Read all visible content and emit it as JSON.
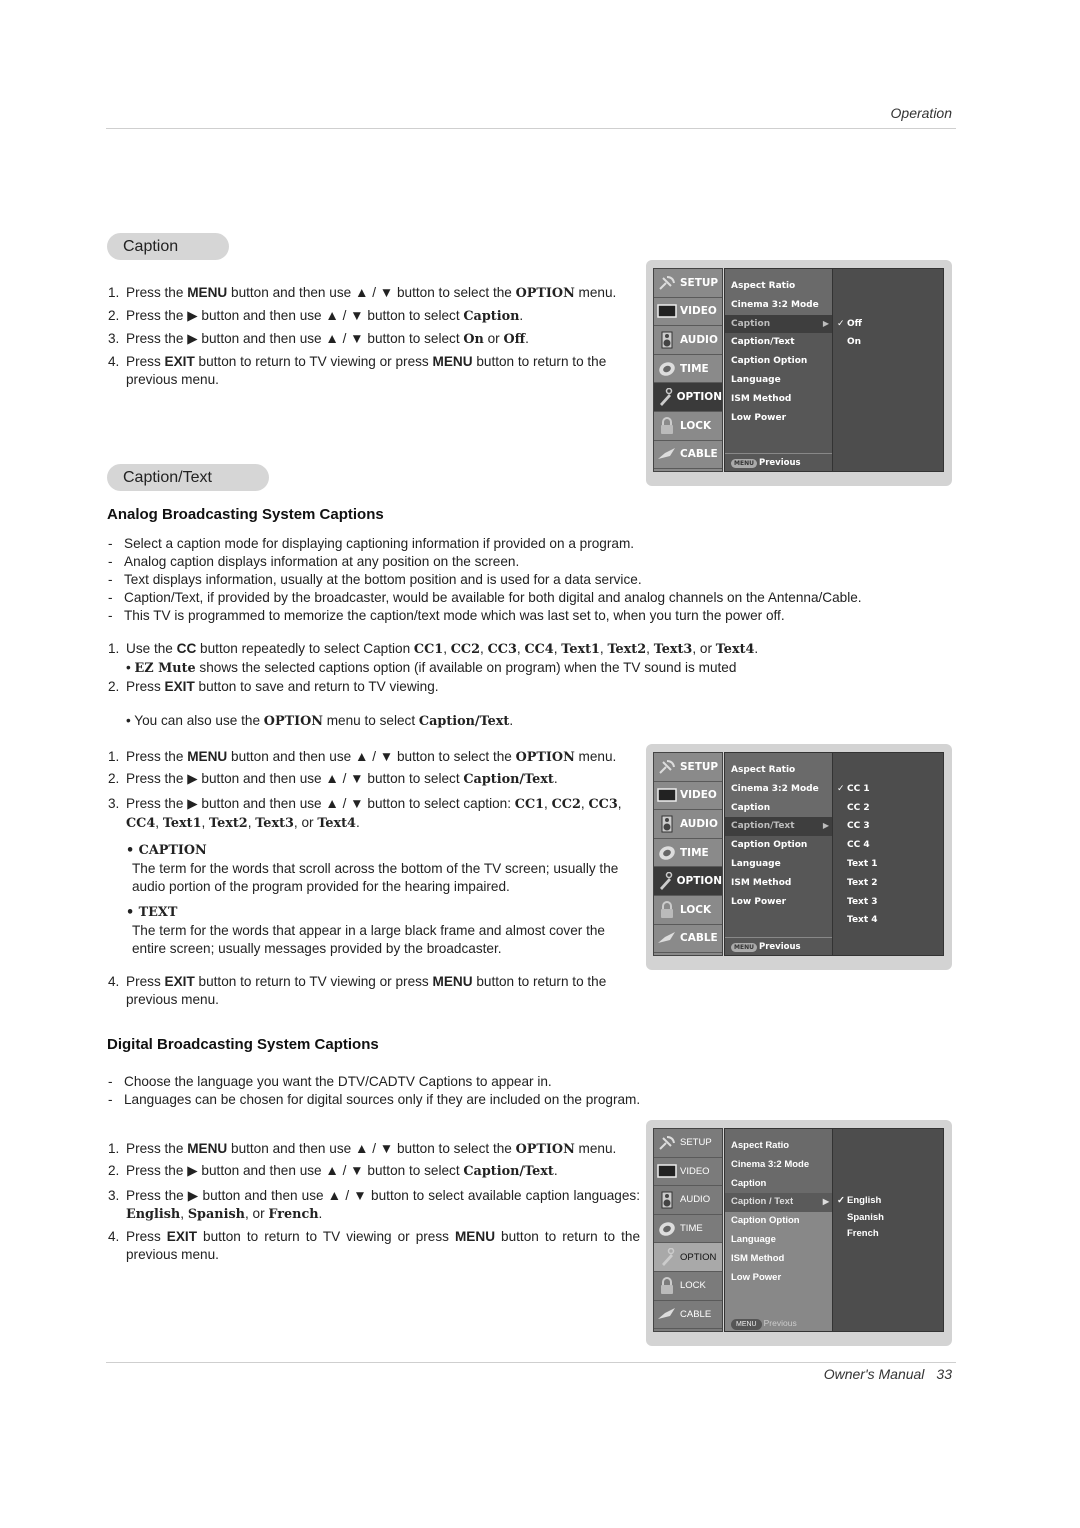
{
  "header": {
    "section": "Operation"
  },
  "footer": {
    "manual": "Owner's Manual",
    "page": "33"
  },
  "caption_section": {
    "title": "Caption",
    "steps": [
      {
        "n": "1.",
        "parts": [
          [
            "t",
            "Press the "
          ],
          [
            "b",
            "MENU"
          ],
          [
            "t",
            " button and then use ▲ / ▼  button to select the "
          ],
          [
            "s",
            "OPTION"
          ],
          [
            "t",
            " menu."
          ]
        ]
      },
      {
        "n": "2.",
        "parts": [
          [
            "t",
            "Press the ▶  button and then use ▲ / ▼ button to select "
          ],
          [
            "s",
            "Caption"
          ],
          [
            "t",
            "."
          ]
        ]
      },
      {
        "n": "3.",
        "parts": [
          [
            "t",
            "Press the ▶  button and then use ▲ / ▼ button to select "
          ],
          [
            "s",
            "On"
          ],
          [
            "t",
            " or "
          ],
          [
            "s",
            "Off"
          ],
          [
            "t",
            "."
          ]
        ]
      },
      {
        "n": "4.",
        "parts": [
          [
            "t",
            "Press "
          ],
          [
            "b",
            "EXIT"
          ],
          [
            "t",
            " button to return to TV viewing or press "
          ],
          [
            "b",
            "MENU"
          ],
          [
            "t",
            " button to return to the previous menu."
          ]
        ]
      }
    ]
  },
  "caption_text_section": {
    "title": "Caption/Text",
    "analog_heading": "Analog Broadcasting System Captions",
    "analog_bullets": [
      "Select a caption mode for displaying captioning information if provided on a program.",
      "Analog caption displays information at any position on the screen.",
      "Text displays information, usually at the bottom position and is used for a data service.",
      "Caption/Text, if provided by the broadcaster, would be available for both digital and analog channels on the Antenna/Cable.",
      "This TV is programmed to memorize the caption/text mode which was last set to, when you turn the power off."
    ],
    "cc_steps": [
      {
        "n": "1.",
        "parts": [
          [
            "t",
            "Use the "
          ],
          [
            "b",
            "CC"
          ],
          [
            "t",
            " button repeatedly to select Caption "
          ],
          [
            "s",
            "CC1"
          ],
          [
            "t",
            ", "
          ],
          [
            "s",
            "CC2"
          ],
          [
            "t",
            ", "
          ],
          [
            "s",
            "CC3"
          ],
          [
            "t",
            ", "
          ],
          [
            "s",
            "CC4"
          ],
          [
            "t",
            ", "
          ],
          [
            "s",
            "Text1"
          ],
          [
            "t",
            ", "
          ],
          [
            "s",
            "Text2"
          ],
          [
            "t",
            ", "
          ],
          [
            "s",
            "Text3"
          ],
          [
            "t",
            ", or "
          ],
          [
            "s",
            "Text4"
          ],
          [
            "t",
            "."
          ]
        ]
      },
      {
        "n": "",
        "parts": [
          [
            "t",
            "• "
          ],
          [
            "s",
            "EZ Mute"
          ],
          [
            "t",
            " shows the selected captions option (if available on program) when the TV sound is muted"
          ]
        ]
      },
      {
        "n": "2.",
        "parts": [
          [
            "t",
            "Press "
          ],
          [
            "b",
            "EXIT"
          ],
          [
            "t",
            " button to save and return to TV viewing."
          ]
        ]
      }
    ],
    "also_note": [
      [
        "t",
        "• You can also use the "
      ],
      [
        "s",
        "OPTION"
      ],
      [
        "t",
        " menu to select "
      ],
      [
        "s",
        "Caption/Text"
      ],
      [
        "t",
        "."
      ]
    ],
    "menu_steps": [
      {
        "n": "1.",
        "parts": [
          [
            "t",
            "Press the "
          ],
          [
            "b",
            "MENU"
          ],
          [
            "t",
            " button and then use ▲ / ▼  button to select the "
          ],
          [
            "s",
            "OPTION"
          ],
          [
            "t",
            " menu."
          ]
        ]
      },
      {
        "n": "2.",
        "parts": [
          [
            "t",
            "Press the ▶  button and then use ▲ / ▼ button to select "
          ],
          [
            "s",
            "Caption/Text"
          ],
          [
            "t",
            "."
          ]
        ]
      },
      {
        "n": "3.",
        "parts": [
          [
            "t",
            "Press the ▶  button and then use ▲ / ▼ button to select caption: "
          ],
          [
            "s",
            "CC1"
          ],
          [
            "t",
            ", "
          ],
          [
            "s",
            "CC2"
          ],
          [
            "t",
            ", "
          ],
          [
            "s",
            "CC3"
          ],
          [
            "t",
            ", "
          ],
          [
            "s",
            "CC4"
          ],
          [
            "t",
            ", "
          ],
          [
            "s",
            "Text1"
          ],
          [
            "t",
            ", "
          ],
          [
            "s",
            "Text2"
          ],
          [
            "t",
            ", "
          ],
          [
            "s",
            "Text3"
          ],
          [
            "t",
            ", or "
          ],
          [
            "s",
            "Text4"
          ],
          [
            "t",
            "."
          ]
        ]
      }
    ],
    "definitions": [
      {
        "term": "• CAPTION",
        "desc": "The term for the words that scroll across the bottom of the TV screen; usually the audio portion of the program provided for the hearing impaired."
      },
      {
        "term": "• TEXT",
        "desc": "The term for the words that appear in a large black frame and almost cover the entire screen; usually messages provided by the broadcaster."
      }
    ],
    "step4": {
      "n": "4.",
      "parts": [
        [
          "t",
          "Press "
        ],
        [
          "b",
          "EXIT"
        ],
        [
          "t",
          " button to return to TV viewing or press "
        ],
        [
          "b",
          "MENU"
        ],
        [
          "t",
          " button to return to the previous menu."
        ]
      ]
    },
    "digital_heading": "Digital Broadcasting System Captions",
    "digital_bullets": [
      "Choose the language you want the DTV/CADTV Captions to appear in.",
      "Languages can be chosen for digital sources only if they are included on the program."
    ],
    "digital_steps": [
      {
        "n": "1.",
        "parts": [
          [
            "t",
            "Press the "
          ],
          [
            "b",
            "MENU"
          ],
          [
            "t",
            " button and then use ▲ / ▼  button to select the "
          ],
          [
            "s",
            "OPTION"
          ],
          [
            "t",
            " menu."
          ]
        ]
      },
      {
        "n": "2.",
        "parts": [
          [
            "t",
            "Press the ▶  button and then use ▲ / ▼ button to select "
          ],
          [
            "s",
            "Caption/Text"
          ],
          [
            "t",
            "."
          ]
        ]
      },
      {
        "n": "3.",
        "parts": [
          [
            "t",
            "Press the ▶  button and then use ▲ / ▼ button to select available caption languages: "
          ],
          [
            "s",
            "English"
          ],
          [
            "t",
            ", "
          ],
          [
            "s",
            "Spanish"
          ],
          [
            "t",
            ", or "
          ],
          [
            "s",
            "French"
          ],
          [
            "t",
            "."
          ]
        ]
      },
      {
        "n": "4.",
        "parts": [
          [
            "t",
            "Press "
          ],
          [
            "b",
            "EXIT"
          ],
          [
            "t",
            " button to return to TV viewing or press "
          ],
          [
            "b",
            "MENU"
          ],
          [
            "t",
            " button to return to the previous menu."
          ]
        ]
      }
    ]
  },
  "tv_menus": [
    {
      "sidebar": [
        {
          "label": "SETUP",
          "icon": "satellite-icon"
        },
        {
          "label": "VIDEO",
          "icon": "screen-icon"
        },
        {
          "label": "AUDIO",
          "icon": "speaker-icon"
        },
        {
          "label": "TIME",
          "icon": "clock-icon"
        },
        {
          "label": "OPTION",
          "icon": "tag-icon",
          "selected": true
        },
        {
          "label": "LOCK",
          "icon": "padlock-icon"
        },
        {
          "label": "CABLE",
          "icon": "plug-icon"
        }
      ],
      "items": [
        "Aspect Ratio",
        "Cinema 3:2 Mode",
        "Caption",
        "Caption/Text",
        "Caption Option",
        "Language",
        "ISM Method",
        "Low Power"
      ],
      "selected_index": 2,
      "arrow": "▶",
      "prev_button": "MENU",
      "prev_label": "Previous",
      "options": [
        {
          "label": "Off",
          "checked": true
        },
        {
          "label": "On"
        }
      ],
      "options_start_row": 2
    },
    {
      "sidebar": [
        {
          "label": "SETUP",
          "icon": "satellite-icon"
        },
        {
          "label": "VIDEO",
          "icon": "screen-icon"
        },
        {
          "label": "AUDIO",
          "icon": "speaker-icon"
        },
        {
          "label": "TIME",
          "icon": "clock-icon"
        },
        {
          "label": "OPTION",
          "icon": "tag-icon",
          "selected": true
        },
        {
          "label": "LOCK",
          "icon": "padlock-icon"
        },
        {
          "label": "CABLE",
          "icon": "plug-icon"
        }
      ],
      "items": [
        "Aspect Ratio",
        "Cinema 3:2 Mode",
        "Caption",
        "Caption/Text",
        "Caption Option",
        "Language",
        "ISM Method",
        "Low Power"
      ],
      "selected_index": 3,
      "arrow": "▶",
      "prev_button": "MENU",
      "prev_label": "Previous",
      "options": [
        {
          "label": "CC 1",
          "checked": true
        },
        {
          "label": "CC 2"
        },
        {
          "label": "CC 3"
        },
        {
          "label": "CC 4"
        },
        {
          "label": "Text 1"
        },
        {
          "label": "Text 2"
        },
        {
          "label": "Text 3"
        },
        {
          "label": "Text 4"
        }
      ],
      "options_start_row": 1
    },
    {
      "sidebar": [
        {
          "label": "SETUP",
          "icon": "satellite-icon"
        },
        {
          "label": "VIDEO",
          "icon": "screen-icon"
        },
        {
          "label": "AUDIO",
          "icon": "speaker-icon"
        },
        {
          "label": "TIME",
          "icon": "clock-icon"
        },
        {
          "label": "OPTION",
          "icon": "tag-icon",
          "selected": true
        },
        {
          "label": "LOCK",
          "icon": "padlock-icon"
        },
        {
          "label": "CABLE",
          "icon": "plug-icon"
        }
      ],
      "items": [
        "Aspect Ratio",
        "Cinema 3:2 Mode",
        "Caption",
        "Caption / Text",
        "Caption Option",
        "Language",
        "ISM Method",
        "Low Power"
      ],
      "selected_index": 3,
      "arrow": "▶",
      "prev_button": "MENU",
      "prev_label": "Previous",
      "options": [
        {
          "label": "English",
          "checked": true
        },
        {
          "label": "Spanish"
        },
        {
          "label": "French"
        }
      ],
      "options_start_row": 3
    }
  ],
  "check_mark": "✓"
}
